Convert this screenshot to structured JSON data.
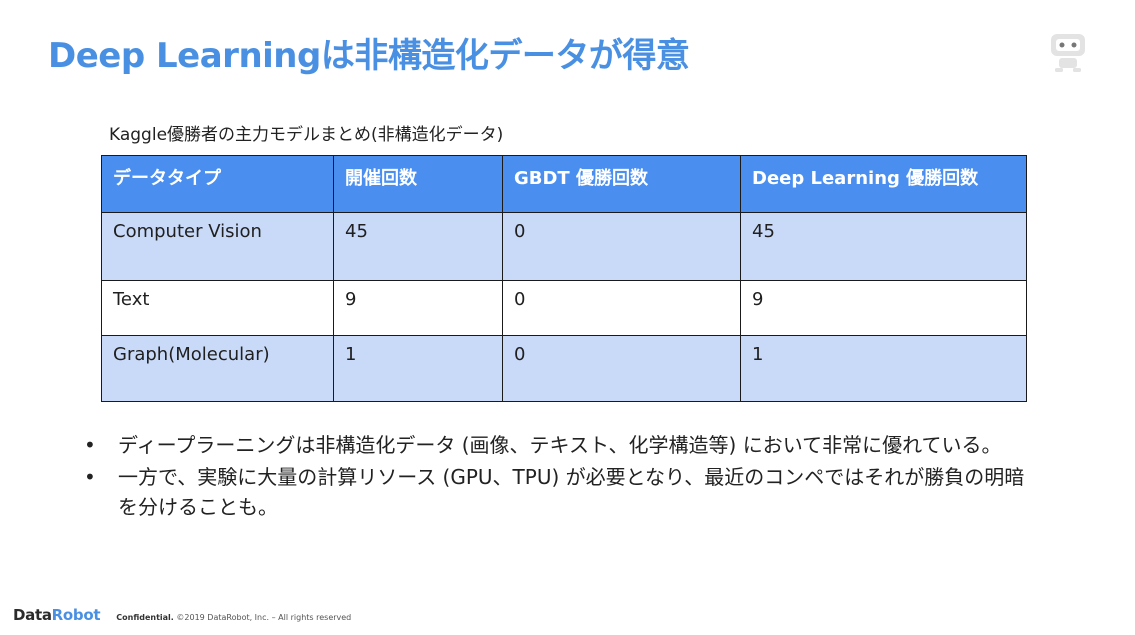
{
  "slide": {
    "title": "Deep Learningは非構造化データが得意",
    "table_caption": "Kaggle優勝者の主力モデルまとめ(非構造化データ)",
    "table": {
      "headers": [
        "データタイプ",
        "開催回数",
        "GBDT 優勝回数",
        "Deep Learning 優勝回数"
      ],
      "rows": [
        [
          "Computer Vision",
          "45",
          "0",
          "45"
        ],
        [
          "Text",
          "9",
          "0",
          "9"
        ],
        [
          "Graph(Molecular)",
          "1",
          "0",
          "1"
        ]
      ]
    },
    "bullets": [
      "ディープラーニングは非構造化データ (画像、テキスト、化学構造等) において非常に優れている。",
      "一方で、実験に大量の計算リソース (GPU、TPU) が必要となり、最近のコンペではそれが勝負の明暗を分けることも。"
    ],
    "bullet_marker": "•"
  },
  "footer": {
    "logo_part1": "Data",
    "logo_part2": "Robot",
    "confidential_label": "Confidential.",
    "copyright": "©2019 DataRobot, Inc. – All rights reserved"
  },
  "colors": {
    "title": "#4a90e2",
    "table_header_bg": "#4a8ff0",
    "table_row_light_blue": "#c9daf8"
  },
  "icons": {
    "top_right": "robot-icon"
  }
}
